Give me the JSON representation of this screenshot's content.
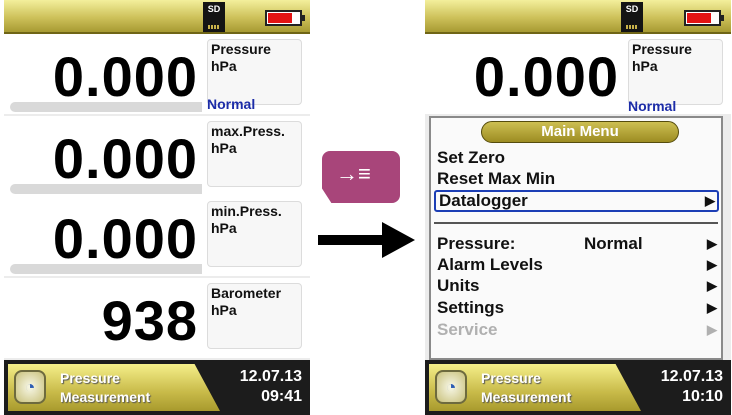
{
  "left_screen": {
    "sd_label": "SD",
    "measurements": [
      {
        "value": "0.000",
        "label": "Pressure",
        "unit": "hPa"
      },
      {
        "value": "0.000",
        "label": "max.Press.",
        "unit": "hPa"
      },
      {
        "value": "0.000",
        "label": "min.Press.",
        "unit": "hPa"
      },
      {
        "value": "938",
        "label": "Barometer",
        "unit": "hPa"
      }
    ],
    "mode": "Normal",
    "footer": {
      "title_line1": "Pressure",
      "title_line2": "Measurement",
      "date": "12.07.13",
      "time": "09:41"
    }
  },
  "right_screen": {
    "sd_label": "SD",
    "measurement": {
      "value": "0.000",
      "label": "Pressure",
      "unit": "hPa"
    },
    "mode": "Normal",
    "menu": {
      "title": "Main Menu",
      "items": [
        {
          "label": "Set Zero"
        },
        {
          "label": "Reset Max Min"
        },
        {
          "label": "Datalogger",
          "arrow": "▶"
        },
        {
          "label": "Pressure:",
          "value": "Normal",
          "arrow": "▶"
        },
        {
          "label": "Alarm Levels",
          "arrow": "▶"
        },
        {
          "label": "Units",
          "arrow": "▶"
        },
        {
          "label": "Settings",
          "arrow": "▶"
        },
        {
          "label": "Service",
          "arrow": "▶"
        }
      ]
    },
    "footer": {
      "title_line1": "Pressure",
      "title_line2": "Measurement",
      "date": "12.07.13",
      "time": "10:10"
    }
  },
  "key_symbol": "→≡",
  "colors": {
    "bar_gold": "#c8ba49",
    "menu_header": "#9c8c22",
    "key_button": "#a8457a",
    "battery_red": "#e31313",
    "selection_blue": "#1c3eb5",
    "mode_blue": "#1c2ca8"
  }
}
